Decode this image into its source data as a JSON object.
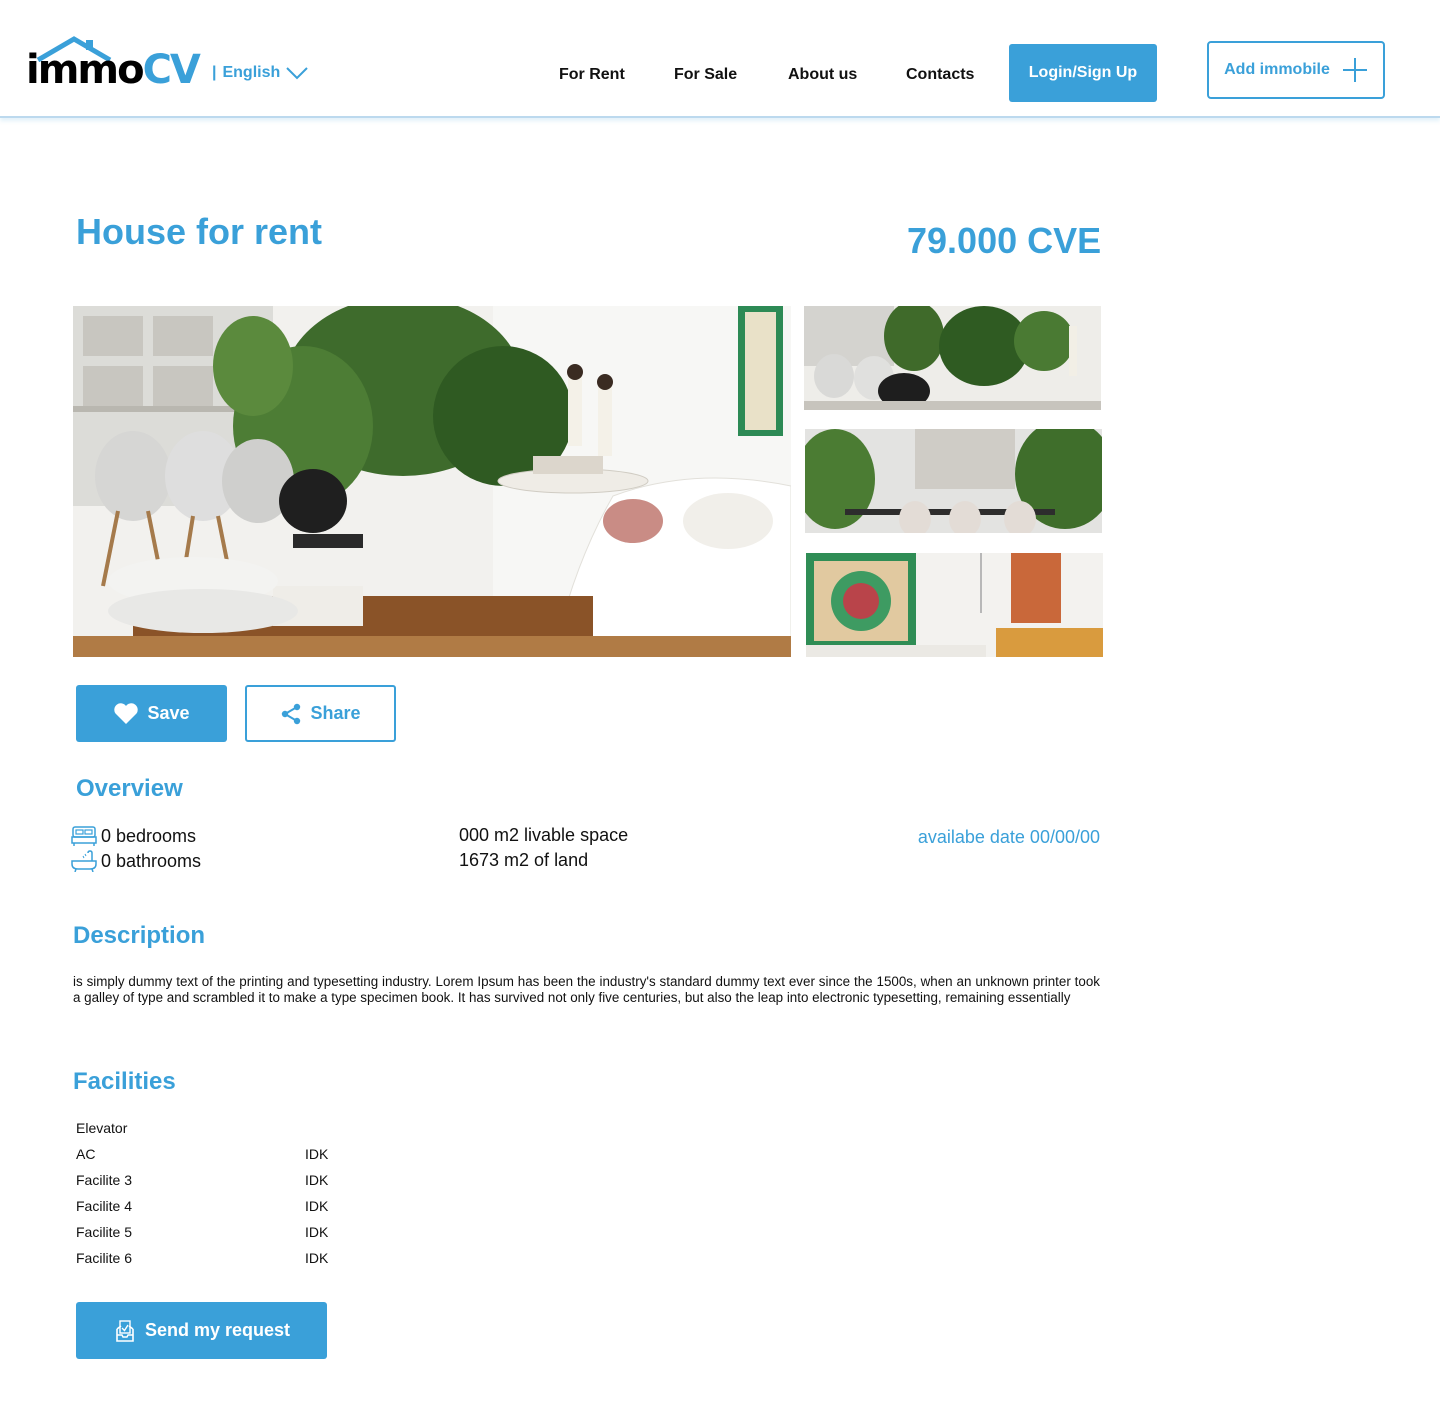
{
  "header": {
    "logo_text_main": "immo",
    "logo_text_accent": "CV",
    "language_separator": "|",
    "language": "English",
    "nav": [
      "For Rent",
      "For Sale",
      "About us",
      "Contacts"
    ],
    "login_label": "Login/Sign Up",
    "add_label": "Add immobile"
  },
  "listing": {
    "title": "House for rent",
    "price": "79.000 CVE"
  },
  "actions": {
    "save_label": "Save",
    "share_label": "Share"
  },
  "overview": {
    "heading": "Overview",
    "bedrooms": "0 bedrooms",
    "bathrooms": "0 bathrooms",
    "livable_space": "000 m2 livable space",
    "land": "1673 m2 of land",
    "available_date": "availabe date 00/00/00"
  },
  "description": {
    "heading": "Description",
    "text": "is simply dummy text of the printing and typesetting industry. Lorem Ipsum has been the industry's standard dummy text ever since the 1500s, when an unknown printer took a galley of type and scrambled it to make a type specimen book. It has survived not only five centuries, but also the leap into electronic typesetting, remaining essentially"
  },
  "facilities": {
    "heading": "Facilities",
    "rows": [
      {
        "name": "Elevator",
        "value": ""
      },
      {
        "name": "AC",
        "value": "IDK"
      },
      {
        "name": "Facilite 3",
        "value": "IDK"
      },
      {
        "name": "Facilite 4",
        "value": "IDK"
      },
      {
        "name": "Facilite 5",
        "value": "IDK"
      },
      {
        "name": "Facilite 6",
        "value": "IDK"
      }
    ]
  },
  "request": {
    "send_label": "Send my request"
  },
  "colors": {
    "accent": "#3aa0d9",
    "text": "#111111"
  }
}
